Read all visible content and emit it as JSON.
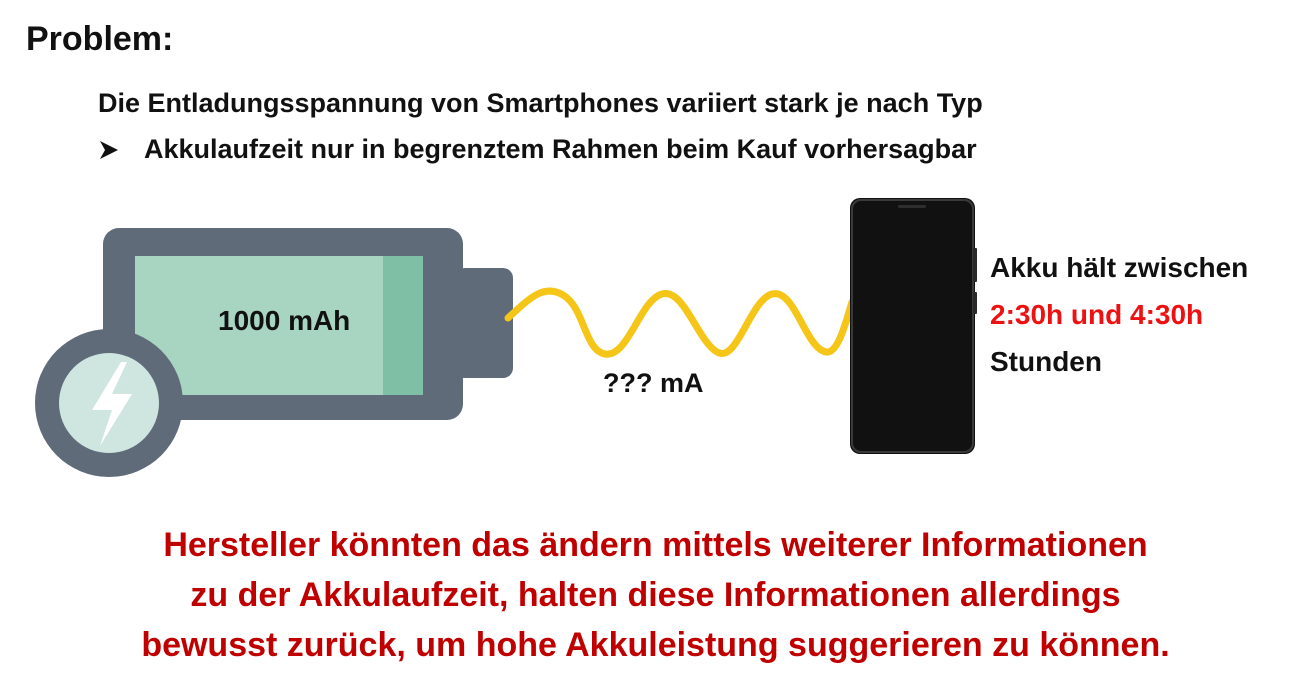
{
  "heading": "Problem:",
  "statement": "Die Entladungsspannung von Smartphones variiert  stark je nach Typ",
  "consequence": "Akkulaufzeit nur in begrenztem Rahmen beim Kauf vorhersagbar",
  "diagram": {
    "battery_capacity": "1000 mAh",
    "current_draw": "??? mA",
    "phone_runtime": {
      "line1": "Akku hält zwischen",
      "line2": "2:30h und 4:30h",
      "line3": "Stunden"
    }
  },
  "conclusion": {
    "line1": "Hersteller könnten das ändern mittels weiterer Informationen",
    "line2": "zu der Akkulaufzeit, halten diese Informationen allerdings",
    "line3": "bewusst zurück, um hohe Akkuleistung suggerieren zu können."
  },
  "colors": {
    "battery_shell": "#5f6b79",
    "battery_fill": "#a8d5c2",
    "battery_fill_end": "#7fbfa6",
    "charge_badge": "#cfe5e0",
    "bolt": "#ffffff",
    "wire": "#f5c518",
    "phone_body": "#111111",
    "highlight_red": "#ee1111",
    "conclusion_red": "#c00000"
  },
  "icons": [
    "arrow-bullet-icon",
    "battery-icon",
    "lightning-bolt-icon",
    "smartphone-icon"
  ]
}
